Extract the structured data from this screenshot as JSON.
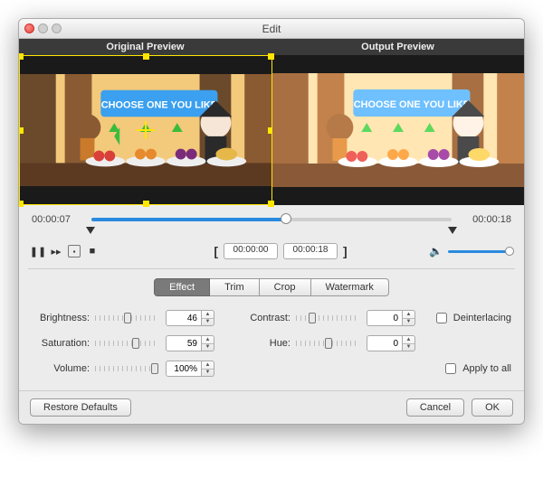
{
  "title": "Edit",
  "previews": {
    "original": "Original Preview",
    "output": "Output Preview"
  },
  "thumbnail_banner": "CHOOSE ONE YOU LIKE",
  "timeline": {
    "start_time": "00:00:07",
    "end_time": "00:00:18",
    "trim_start": "00:00:00",
    "trim_end": "00:00:18"
  },
  "tabs": {
    "effect": "Effect",
    "trim": "Trim",
    "crop": "Crop",
    "watermark": "Watermark",
    "active": "effect"
  },
  "settings": {
    "brightness": {
      "label": "Brightness:",
      "value": "46"
    },
    "contrast": {
      "label": "Contrast:",
      "value": "0"
    },
    "saturation": {
      "label": "Saturation:",
      "value": "59"
    },
    "hue": {
      "label": "Hue:",
      "value": "0"
    },
    "volume": {
      "label": "Volume:",
      "value": "100%"
    },
    "deinterlacing": "Deinterlacing",
    "apply_all": "Apply to all"
  },
  "buttons": {
    "restore": "Restore Defaults",
    "cancel": "Cancel",
    "ok": "OK"
  }
}
